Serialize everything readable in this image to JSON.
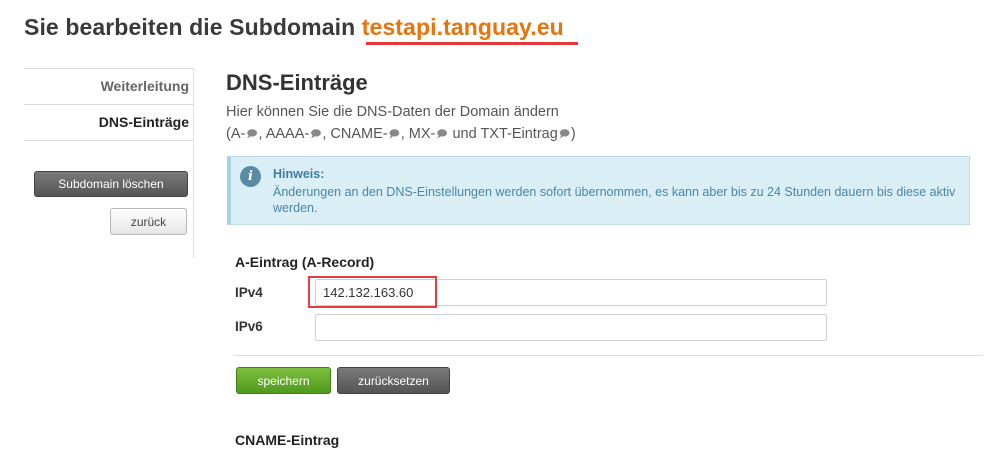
{
  "header": {
    "title_prefix": "Sie bearbeiten die Subdomain ",
    "domain": "testapi.tanguay.eu"
  },
  "sidebar": {
    "tabs": [
      {
        "label": "Weiterleitung",
        "active": false
      },
      {
        "label": "DNS-Einträge",
        "active": true
      }
    ],
    "delete_button": "Subdomain löschen",
    "back_button": "zurück"
  },
  "main": {
    "title": "DNS-Einträge",
    "intro_line1": "Hier können Sie die DNS-Daten der Domain ändern",
    "intro_line2_parts": [
      "(A-",
      ", AAAA-",
      ", CNAME-",
      ", MX-",
      " und TXT-Eintrag",
      ")"
    ],
    "info": {
      "title": "Hinweis:",
      "text": "Änderungen an den DNS-Einstellungen werden sofort übernommen, es kann aber bis zu 24 Stunden dauern bis diese aktiv werden."
    },
    "a_record": {
      "title": "A-Eintrag (A-Record)",
      "ipv4_label": "IPv4",
      "ipv4_value": "142.132.163.60",
      "ipv6_label": "IPv6",
      "ipv6_value": ""
    },
    "save_button": "speichern",
    "reset_button": "zurücksetzen",
    "cname_title": "CNAME-Eintrag"
  },
  "icons": {
    "info": "info-icon",
    "external_link": "external-link-icon"
  },
  "colors": {
    "accent_domain": "#e8740c",
    "highlight": "#e04040",
    "info_bg": "#d9eef5",
    "save_green": "#5aa624"
  }
}
